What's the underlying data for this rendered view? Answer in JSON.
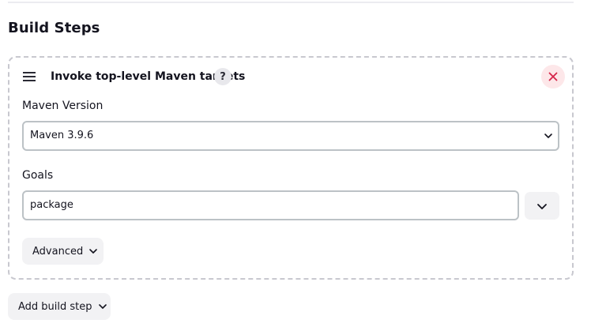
{
  "section": {
    "title": "Build Steps"
  },
  "step": {
    "title": "Invoke top-level Maven targets",
    "help_label": "?",
    "maven_version": {
      "label": "Maven Version",
      "selected": "Maven 3.9.6"
    },
    "goals": {
      "label": "Goals",
      "value": "package"
    },
    "advanced_label": "Advanced"
  },
  "footer": {
    "add_build_step_label": "Add build step"
  },
  "colors": {
    "remove_accent": "#d6264a",
    "remove_bg": "#fde7e9",
    "button_bg": "#f2f2f4",
    "input_border": "#bcc2c6"
  },
  "icons": {
    "drag": "drag-handle-icon",
    "help": "help-icon",
    "remove": "close-icon",
    "dropdown": "chevron-down-icon"
  }
}
